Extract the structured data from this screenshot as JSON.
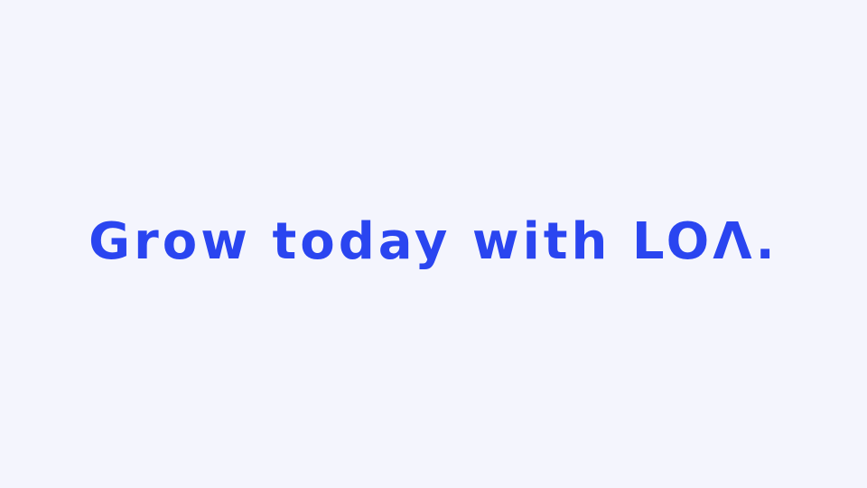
{
  "page": {
    "background_color": "#f4f5fd",
    "accent_color": "#2a45f0"
  },
  "hero": {
    "headline": "Grow today with LOΛ."
  }
}
